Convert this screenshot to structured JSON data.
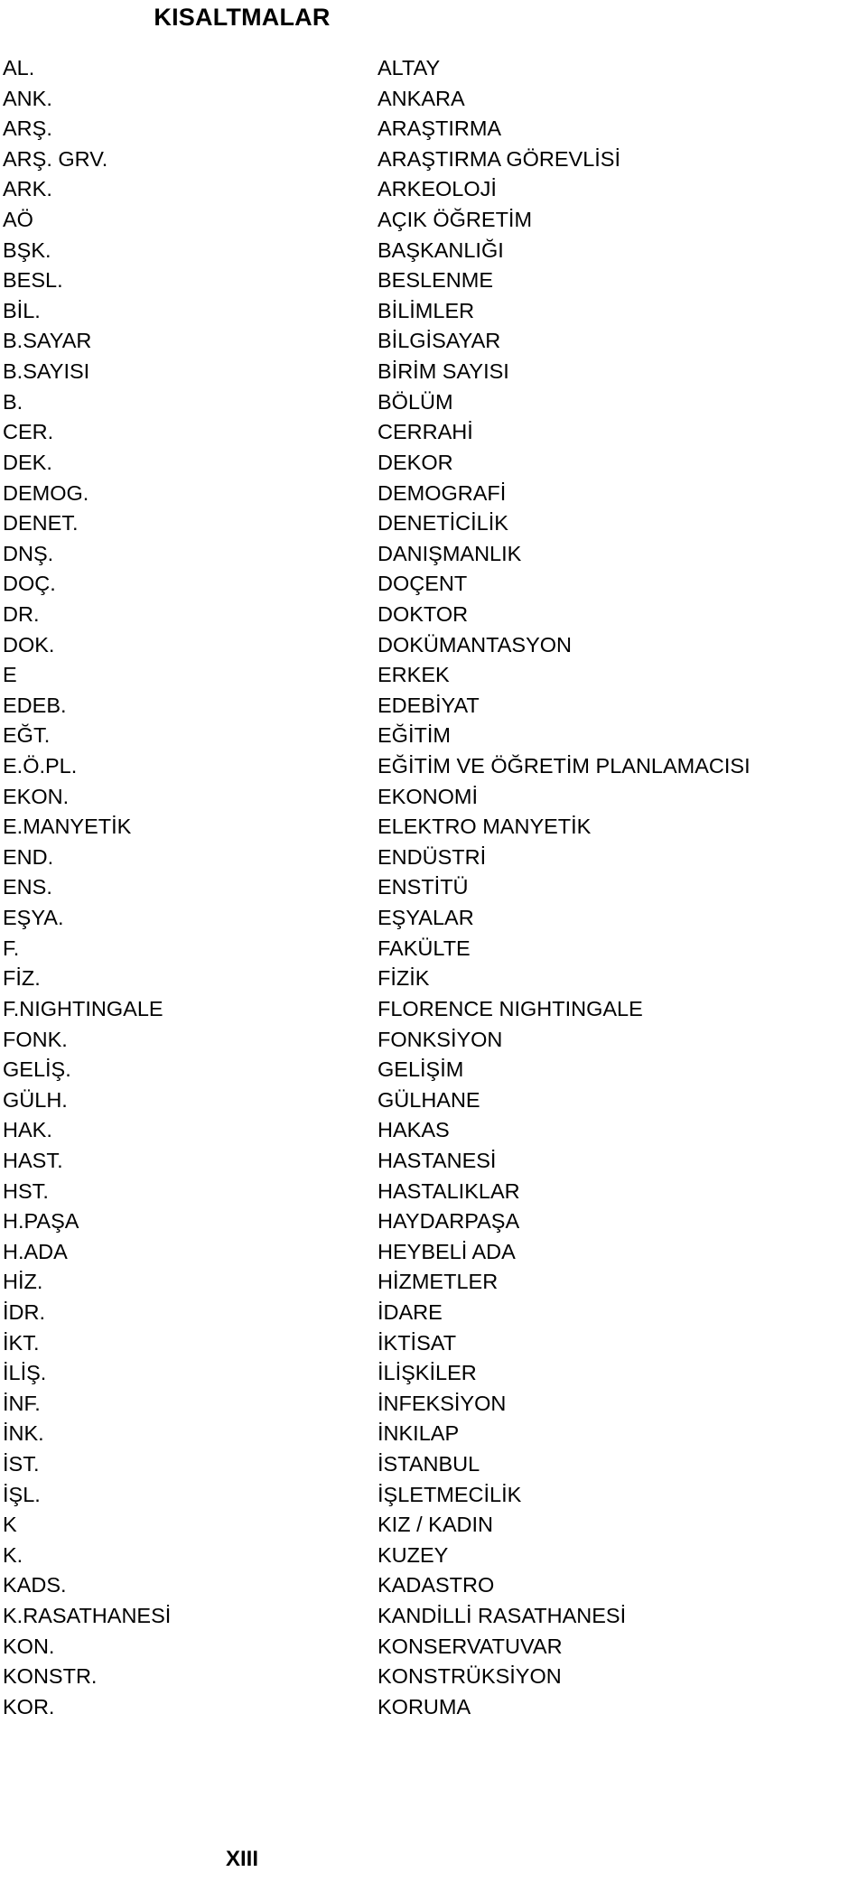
{
  "document": {
    "title": "KISALTMALAR",
    "page_number": "XIII"
  },
  "abbreviations": [
    {
      "term": "AL.",
      "definition": "ALTAY"
    },
    {
      "term": "ANK.",
      "definition": "ANKARA"
    },
    {
      "term": "ARŞ.",
      "definition": "ARAŞTIRMA"
    },
    {
      "term": "ARŞ. GRV.",
      "definition": "ARAŞTIRMA GÖREVLİSİ"
    },
    {
      "term": "ARK.",
      "definition": "ARKEOLOJİ"
    },
    {
      "term": "AÖ",
      "definition": "AÇIK ÖĞRETİM"
    },
    {
      "term": "BŞK.",
      "definition": "BAŞKANLIĞI"
    },
    {
      "term": "BESL.",
      "definition": "BESLENME"
    },
    {
      "term": "BİL.",
      "definition": "BİLİMLER"
    },
    {
      "term": "B.SAYAR",
      "definition": "BİLGİSAYAR"
    },
    {
      "term": "B.SAYISI",
      "definition": "BİRİM SAYISI"
    },
    {
      "term": "B.",
      "definition": "BÖLÜM"
    },
    {
      "term": "CER.",
      "definition": "CERRAHİ"
    },
    {
      "term": "DEK.",
      "definition": "DEKOR"
    },
    {
      "term": "DEMOG.",
      "definition": "DEMOGRAFİ"
    },
    {
      "term": "DENET.",
      "definition": "DENETİCİLİK"
    },
    {
      "term": "DNŞ.",
      "definition": "DANIŞMANLIK"
    },
    {
      "term": "DOÇ.",
      "definition": "DOÇENT"
    },
    {
      "term": "DR.",
      "definition": "DOKTOR"
    },
    {
      "term": "DOK.",
      "definition": "DOKÜMANTASYON"
    },
    {
      "term": "E",
      "definition": "ERKEK"
    },
    {
      "term": "EDEB.",
      "definition": "EDEBİYAT"
    },
    {
      "term": "EĞT.",
      "definition": "EĞİTİM"
    },
    {
      "term": "E.Ö.PL.",
      "definition": "EĞİTİM VE ÖĞRETİM PLANLAMACISI"
    },
    {
      "term": "EKON.",
      "definition": "EKONOMİ"
    },
    {
      "term": "E.MANYETİK",
      "definition": "ELEKTRO MANYETİK"
    },
    {
      "term": "END.",
      "definition": "ENDÜSTRİ"
    },
    {
      "term": "ENS.",
      "definition": "ENSTİTÜ"
    },
    {
      "term": "EŞYA.",
      "definition": "EŞYALAR"
    },
    {
      "term": "F.",
      "definition": "FAKÜLTE"
    },
    {
      "term": "FİZ.",
      "definition": "FİZİK"
    },
    {
      "term": "F.NIGHTINGALE",
      "definition": "FLORENCE NIGHTINGALE"
    },
    {
      "term": "FONK.",
      "definition": "FONKSİYON"
    },
    {
      "term": "GELİŞ.",
      "definition": "GELİŞİM"
    },
    {
      "term": "GÜLH.",
      "definition": "GÜLHANE"
    },
    {
      "term": "HAK.",
      "definition": "HAKAS"
    },
    {
      "term": "HAST.",
      "definition": "HASTANESİ"
    },
    {
      "term": "HST.",
      "definition": "HASTALIKLAR"
    },
    {
      "term": "H.PAŞA",
      "definition": "HAYDARPAŞA"
    },
    {
      "term": "H.ADA",
      "definition": "HEYBELİ ADA"
    },
    {
      "term": "HİZ.",
      "definition": "HİZMETLER"
    },
    {
      "term": "İDR.",
      "definition": "İDARE"
    },
    {
      "term": "İKT.",
      "definition": "İKTİSAT"
    },
    {
      "term": "İLİŞ.",
      "definition": "İLİŞKİLER"
    },
    {
      "term": "İNF.",
      "definition": "İNFEKSİYON"
    },
    {
      "term": "İNK.",
      "definition": "İNKILAP"
    },
    {
      "term": "İST.",
      "definition": "İSTANBUL"
    },
    {
      "term": "İŞL.",
      "definition": "İŞLETMECİLİK"
    },
    {
      "term": "K",
      "definition": "KIZ / KADIN"
    },
    {
      "term": "K.",
      "definition": "KUZEY"
    },
    {
      "term": "KADS.",
      "definition": "KADASTRO"
    },
    {
      "term": "K.RASATHANESİ",
      "definition": "KANDİLLİ RASATHANESİ"
    },
    {
      "term": "KON.",
      "definition": "KONSERVATUVAR"
    },
    {
      "term": "KONSTR.",
      "definition": "KONSTRÜKSİYON"
    },
    {
      "term": "KOR.",
      "definition": "KORUMA"
    }
  ]
}
